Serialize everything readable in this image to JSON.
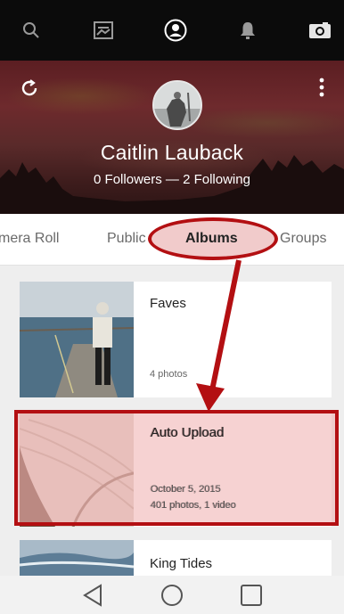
{
  "topnav": {
    "icons": [
      "search-icon",
      "photos-icon",
      "profile-icon",
      "notifications-icon",
      "camera-icon"
    ]
  },
  "profile": {
    "name": "Caitlin Lauback",
    "stats": "0 Followers — 2 Following"
  },
  "tabs": [
    {
      "label": "mera Roll"
    },
    {
      "label": "Public"
    },
    {
      "label": "Albums",
      "active": true
    },
    {
      "label": "Groups"
    }
  ],
  "albums": [
    {
      "title": "Faves",
      "date": "",
      "count": "4 photos"
    },
    {
      "title": "Auto Upload",
      "date": "October 5, 2015",
      "count": "401 photos, 1 video"
    },
    {
      "title": "King Tides",
      "date": "",
      "count": ""
    }
  ],
  "colors": {
    "annotation": "#b30f12",
    "header_tint": "#5b1e22"
  }
}
